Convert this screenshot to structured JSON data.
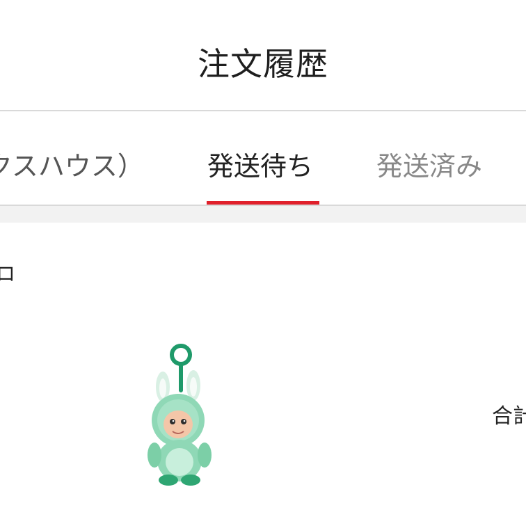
{
  "header": {
    "title": "注文履歴"
  },
  "tabs": [
    {
      "label": "クスハウス）",
      "active": false
    },
    {
      "label": "発送待ち",
      "active": true
    },
    {
      "label": "発送済み",
      "active": false
    }
  ],
  "colors": {
    "accent": "#e0202b",
    "divider": "#d9d9d9",
    "band": "#f2f2f2"
  },
  "order": {
    "store_fragment": "ロ",
    "product_image_icon": "plush-keychain-icon",
    "total_label_fragment": "合計"
  }
}
